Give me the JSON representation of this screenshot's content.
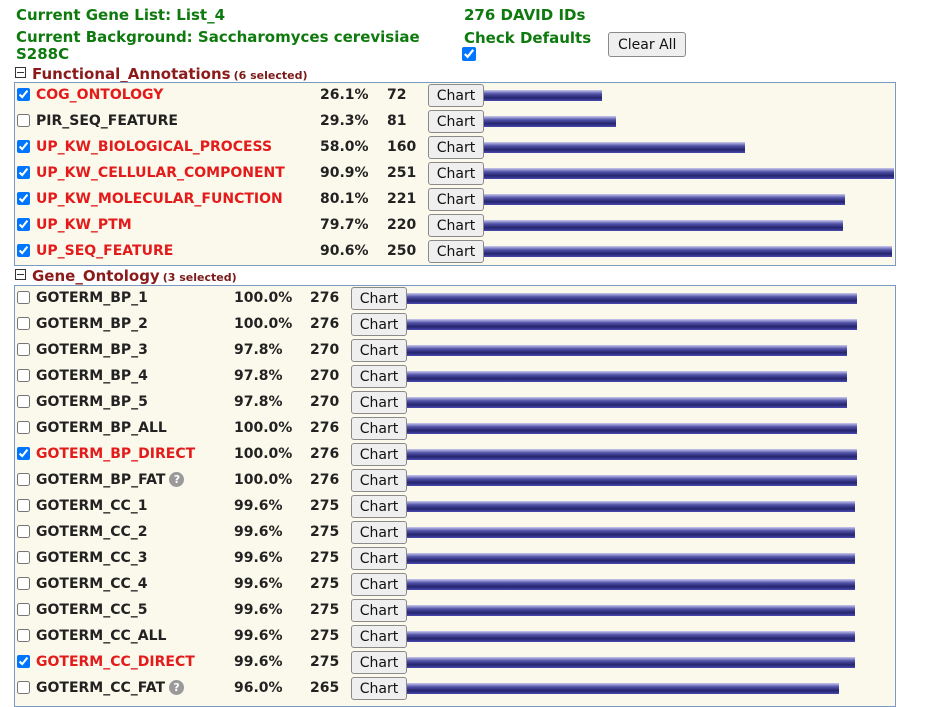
{
  "header": {
    "gene_list": "Current Gene List: List_4",
    "background": "Current Background: Saccharomyces cerevisiae S288C",
    "david_ids": "276 DAVID IDs",
    "check_defaults": "Check Defaults",
    "clear_all": "Clear All"
  },
  "colors": {
    "header": "#0e7a0e",
    "section": "#8b1a1a",
    "selected": "#e31b1b",
    "bar": "#2e2e84"
  },
  "chart_label": "Chart",
  "functional": {
    "title": "Functional_Annotations",
    "selected_text": "(6 selected)",
    "max_count": 251,
    "rows": [
      {
        "name": "COG_ONTOLOGY",
        "pct": "26.1%",
        "count": 72,
        "checked": true
      },
      {
        "name": "PIR_SEQ_FEATURE",
        "pct": "29.3%",
        "count": 81,
        "checked": false
      },
      {
        "name": "UP_KW_BIOLOGICAL_PROCESS",
        "pct": "58.0%",
        "count": 160,
        "checked": true
      },
      {
        "name": "UP_KW_CELLULAR_COMPONENT",
        "pct": "90.9%",
        "count": 251,
        "checked": true
      },
      {
        "name": "UP_KW_MOLECULAR_FUNCTION",
        "pct": "80.1%",
        "count": 221,
        "checked": true
      },
      {
        "name": "UP_KW_PTM",
        "pct": "79.7%",
        "count": 220,
        "checked": true
      },
      {
        "name": "UP_SEQ_FEATURE",
        "pct": "90.6%",
        "count": 250,
        "checked": true
      }
    ]
  },
  "gene_ontology": {
    "title": "Gene_Ontology",
    "selected_text": "(3 selected)",
    "max_count": 276,
    "rows": [
      {
        "name": "GOTERM_BP_1",
        "pct": "100.0%",
        "count": 276,
        "checked": false,
        "help": false
      },
      {
        "name": "GOTERM_BP_2",
        "pct": "100.0%",
        "count": 276,
        "checked": false,
        "help": false
      },
      {
        "name": "GOTERM_BP_3",
        "pct": "97.8%",
        "count": 270,
        "checked": false,
        "help": false
      },
      {
        "name": "GOTERM_BP_4",
        "pct": "97.8%",
        "count": 270,
        "checked": false,
        "help": false
      },
      {
        "name": "GOTERM_BP_5",
        "pct": "97.8%",
        "count": 270,
        "checked": false,
        "help": false
      },
      {
        "name": "GOTERM_BP_ALL",
        "pct": "100.0%",
        "count": 276,
        "checked": false,
        "help": false
      },
      {
        "name": "GOTERM_BP_DIRECT",
        "pct": "100.0%",
        "count": 276,
        "checked": true,
        "help": false
      },
      {
        "name": "GOTERM_BP_FAT",
        "pct": "100.0%",
        "count": 276,
        "checked": false,
        "help": true
      },
      {
        "name": "GOTERM_CC_1",
        "pct": "99.6%",
        "count": 275,
        "checked": false,
        "help": false
      },
      {
        "name": "GOTERM_CC_2",
        "pct": "99.6%",
        "count": 275,
        "checked": false,
        "help": false
      },
      {
        "name": "GOTERM_CC_3",
        "pct": "99.6%",
        "count": 275,
        "checked": false,
        "help": false
      },
      {
        "name": "GOTERM_CC_4",
        "pct": "99.6%",
        "count": 275,
        "checked": false,
        "help": false
      },
      {
        "name": "GOTERM_CC_5",
        "pct": "99.6%",
        "count": 275,
        "checked": false,
        "help": false
      },
      {
        "name": "GOTERM_CC_ALL",
        "pct": "99.6%",
        "count": 275,
        "checked": false,
        "help": false
      },
      {
        "name": "GOTERM_CC_DIRECT",
        "pct": "99.6%",
        "count": 275,
        "checked": true,
        "help": false
      },
      {
        "name": "GOTERM_CC_FAT",
        "pct": "96.0%",
        "count": 265,
        "checked": false,
        "help": true
      }
    ]
  }
}
